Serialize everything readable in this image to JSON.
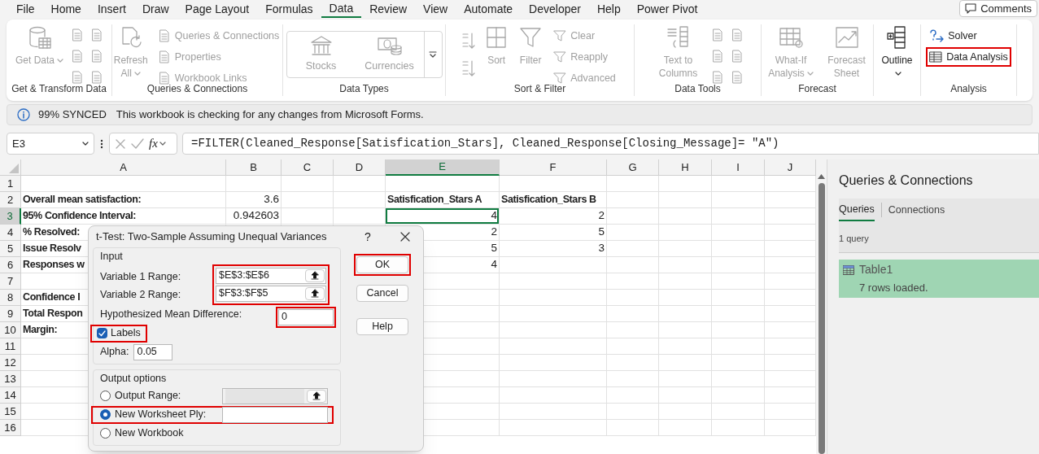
{
  "menu_tabs": [
    {
      "label": "File",
      "selected": false
    },
    {
      "label": "Home",
      "selected": false
    },
    {
      "label": "Insert",
      "selected": false
    },
    {
      "label": "Draw",
      "selected": false
    },
    {
      "label": "Page Layout",
      "selected": false
    },
    {
      "label": "Formulas",
      "selected": false
    },
    {
      "label": "Data",
      "selected": true
    },
    {
      "label": "Review",
      "selected": false
    },
    {
      "label": "View",
      "selected": false
    },
    {
      "label": "Automate",
      "selected": false
    },
    {
      "label": "Developer",
      "selected": false
    },
    {
      "label": "Help",
      "selected": false
    },
    {
      "label": "Power Pivot",
      "selected": false
    }
  ],
  "comments_button": "Comments",
  "ribbon_groups": [
    {
      "label": "Get & Transform Data",
      "items": [
        {
          "kind": "large",
          "label": "Get Data",
          "disabled": true,
          "dropdown": true
        },
        {
          "kind": "icon_column"
        },
        {
          "kind": "icon_column"
        }
      ]
    },
    {
      "label": "Queries & Connections",
      "items": [
        {
          "kind": "large",
          "label": "Refresh All",
          "disabled": true,
          "dropdown": true
        },
        {
          "kind": "stack",
          "entries": [
            {
              "label": "Queries & Connections",
              "disabled": true
            },
            {
              "label": "Properties",
              "disabled": true
            },
            {
              "label": "Workbook Links",
              "disabled": true
            }
          ]
        }
      ]
    },
    {
      "label": "Data Types",
      "items": [
        {
          "kind": "gallery",
          "entries": [
            {
              "label": "Stocks",
              "disabled": true
            },
            {
              "label": "Currencies",
              "disabled": true
            }
          ]
        }
      ]
    },
    {
      "label": "Sort & Filter",
      "items": [
        {
          "kind": "sort_column"
        },
        {
          "kind": "large",
          "label": "Sort",
          "disabled": true
        },
        {
          "kind": "large",
          "label": "Filter",
          "disabled": true
        },
        {
          "kind": "stack",
          "entries": [
            {
              "label": "Clear",
              "disabled": true
            },
            {
              "label": "Reapply",
              "disabled": true
            },
            {
              "label": "Advanced",
              "disabled": true
            }
          ]
        }
      ]
    },
    {
      "label": "Data Tools",
      "items": [
        {
          "kind": "large",
          "label": "Text to Columns",
          "disabled": true
        },
        {
          "kind": "icon_column"
        },
        {
          "kind": "icon_column"
        }
      ]
    },
    {
      "label": "Forecast",
      "items": [
        {
          "kind": "large",
          "label": "What-If Analysis",
          "disabled": true,
          "dropdown": true
        },
        {
          "kind": "large",
          "label": "Forecast Sheet",
          "disabled": true
        }
      ]
    },
    {
      "items": [
        {
          "kind": "large",
          "label": "Outline",
          "disabled": false,
          "dropdown": true
        }
      ]
    },
    {
      "label": "Analysis",
      "items": [
        {
          "kind": "stack",
          "entries": [
            {
              "label": "Solver",
              "disabled": false,
              "highlighted": false
            },
            {
              "label": "Data Analysis",
              "disabled": false,
              "highlighted": true
            }
          ]
        }
      ]
    }
  ],
  "info_bar": {
    "status": "99% SYNCED",
    "message": "This workbook is checking for any changes from Microsoft Forms."
  },
  "formula_bar": {
    "name_box": "E3",
    "fx": "fx",
    "formula": "=FILTER(Cleaned_Response[Satisfication_Stars], Cleaned_Response[Closing_Message]= \"A\")"
  },
  "sheet": {
    "columns": [
      {
        "label": "A",
        "selected": false
      },
      {
        "label": "B",
        "selected": false
      },
      {
        "label": "C",
        "selected": false
      },
      {
        "label": "D",
        "selected": false
      },
      {
        "label": "E",
        "selected": true
      },
      {
        "label": "F",
        "selected": false
      },
      {
        "label": "G",
        "selected": false
      },
      {
        "label": "H",
        "selected": false
      },
      {
        "label": "I",
        "selected": false
      },
      {
        "label": "J",
        "selected": false
      }
    ],
    "rows": [
      {
        "label": "1",
        "selected": false,
        "cells": {}
      },
      {
        "label": "2",
        "selected": false,
        "cells": {
          "A": {
            "text": "Overall mean satisfaction:",
            "bold": true
          },
          "B": {
            "text": "3.6",
            "kind": "number"
          },
          "E": {
            "text": "Satisfication_Stars A",
            "bold": true
          },
          "F": {
            "text": "Satisfication_Stars B",
            "bold": true
          }
        }
      },
      {
        "label": "3",
        "selected": true,
        "cells": {
          "A": {
            "text": "95% Confidence Interval:",
            "bold": true
          },
          "B": {
            "text": "0.942603",
            "kind": "number"
          },
          "E": {
            "text": "4",
            "kind": "number",
            "active": true
          },
          "F": {
            "text": "2",
            "kind": "number"
          }
        }
      },
      {
        "label": "4",
        "selected": false,
        "cells": {
          "A": {
            "text": "% Resolved:",
            "bold": true
          },
          "E": {
            "text": "2",
            "kind": "number"
          },
          "F": {
            "text": "5",
            "kind": "number"
          }
        }
      },
      {
        "label": "5",
        "selected": false,
        "cells": {
          "A": {
            "text": "Issue Resolv",
            "bold": true
          },
          "E": {
            "text": "5",
            "kind": "number"
          },
          "F": {
            "text": "3",
            "kind": "number"
          }
        }
      },
      {
        "label": "6",
        "selected": false,
        "cells": {
          "A": {
            "text": "Responses w",
            "bold": true
          },
          "E": {
            "text": "4",
            "kind": "number"
          }
        }
      },
      {
        "label": "7",
        "selected": false,
        "cells": {}
      },
      {
        "label": "8",
        "selected": false,
        "cells": {
          "A": {
            "text": "Confidence I",
            "bold": true
          }
        }
      },
      {
        "label": "9",
        "selected": false,
        "cells": {
          "A": {
            "text": "Total Respon",
            "bold": true
          }
        }
      },
      {
        "label": "10",
        "selected": false,
        "cells": {
          "A": {
            "text": "Margin:",
            "bold": true
          }
        }
      },
      {
        "label": "11",
        "selected": false,
        "cells": {}
      },
      {
        "label": "12",
        "selected": false,
        "cells": {}
      },
      {
        "label": "13",
        "selected": false,
        "cells": {}
      },
      {
        "label": "14",
        "selected": false,
        "cells": {}
      },
      {
        "label": "15",
        "selected": false,
        "cells": {}
      },
      {
        "label": "16",
        "selected": false,
        "cells": {}
      }
    ]
  },
  "dialog": {
    "title": "t-Test: Two-Sample Assuming Unequal Variances",
    "help_glyph": "?",
    "input_group": {
      "label": "Input",
      "ranges_highlighted": true,
      "ranges": [
        {
          "label": "Variable 1 Range:",
          "value": "$E$3:$E$6"
        },
        {
          "label": "Variable 2 Range:",
          "value": "$F$3:$F$5"
        }
      ],
      "mean_difference": {
        "label": "Hypothesized Mean Difference:",
        "value": "0",
        "highlighted": true
      },
      "labels": {
        "label": "Labels",
        "checked": true,
        "highlighted": true
      },
      "alpha": {
        "label": "Alpha:",
        "value": "0.05"
      }
    },
    "output_group": {
      "label": "Output options",
      "options": [
        {
          "label": "Output Range:",
          "selected": false,
          "highlighted": false,
          "field": {
            "disabled": true,
            "picker": true
          }
        },
        {
          "label": "New Worksheet Ply:",
          "selected": true,
          "highlighted": true,
          "field": {
            "disabled": false,
            "picker": false
          }
        },
        {
          "label": "New Workbook",
          "selected": false,
          "highlighted": false
        }
      ]
    },
    "buttons": [
      {
        "label": "OK",
        "highlighted": true
      },
      {
        "label": "Cancel",
        "highlighted": false
      },
      {
        "label": "Help",
        "highlighted": false
      }
    ]
  },
  "panel": {
    "title": "Queries & Connections",
    "tabs": [
      {
        "label": "Queries",
        "selected": true
      },
      {
        "label": "Connections",
        "selected": false
      }
    ],
    "count": "1 query",
    "queries": [
      {
        "name": "Table1",
        "status": "7 rows loaded.",
        "selected": true
      }
    ]
  }
}
